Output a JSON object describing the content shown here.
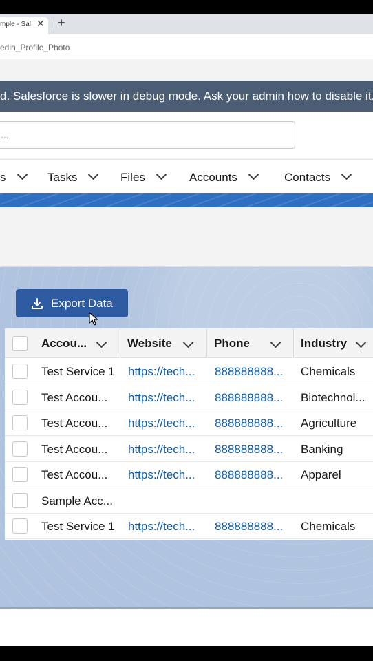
{
  "browser": {
    "tab_title": "mple - Sal",
    "tab_close": "✕",
    "new_tab": "+",
    "address": "edin_Profile_Photo"
  },
  "debug_banner": "d. Salesforce is slower in debug mode. Ask your admin how to disable it.",
  "search": {
    "value": "..."
  },
  "nav": {
    "items": [
      {
        "label": "s"
      },
      {
        "label": "Tasks"
      },
      {
        "label": "Files"
      },
      {
        "label": "Accounts"
      },
      {
        "label": "Contacts"
      }
    ]
  },
  "export_button": {
    "label": "Export Data",
    "icon": "download-icon"
  },
  "table": {
    "columns": [
      {
        "label": "Accou..."
      },
      {
        "label": "Website"
      },
      {
        "label": "Phone"
      },
      {
        "label": "Industry"
      }
    ],
    "rows": [
      {
        "name": "Test Service 1",
        "website": "https://tech...",
        "phone": "888888888...",
        "industry": "Chemicals"
      },
      {
        "name": "Test Accou...",
        "website": "https://tech...",
        "phone": "888888888...",
        "industry": "Biotechnol..."
      },
      {
        "name": "Test Accou...",
        "website": "https://tech...",
        "phone": "888888888...",
        "industry": "Agriculture"
      },
      {
        "name": "Test Accou...",
        "website": "https://tech...",
        "phone": "888888888...",
        "industry": "Banking"
      },
      {
        "name": "Test Accou...",
        "website": "https://tech...",
        "phone": "888888888...",
        "industry": "Apparel"
      },
      {
        "name": "Sample Acc...",
        "website": "",
        "phone": "",
        "industry": ""
      },
      {
        "name": "Test Service 1",
        "website": "https://tech...",
        "phone": "888888888...",
        "industry": "Chemicals"
      }
    ]
  },
  "colors": {
    "banner": "#4b5c75",
    "brand_blue": "#2e6fc2",
    "button": "#2d5aa0",
    "link": "#0b5cab"
  }
}
